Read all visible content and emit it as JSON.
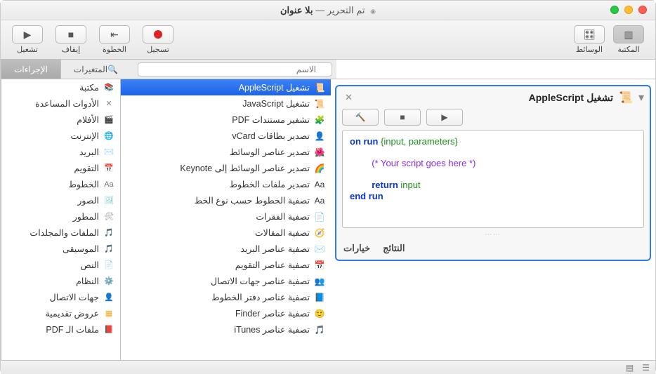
{
  "window": {
    "title_prefix": "تم التحرير — ",
    "title_doc": "بلا عنوان"
  },
  "toolbar": {
    "library": "المكتبة",
    "media": "الوسائط",
    "record": "تسجيل",
    "step": "الخطوة",
    "stop": "إيقاف",
    "run": "تشغيل"
  },
  "tabs": {
    "actions": "الإجراءات",
    "variables": "المتغيرات",
    "search_placeholder": "الاسم"
  },
  "categories": [
    {
      "icon": "📚",
      "color": "#a0d468",
      "label": "مكتبة"
    },
    {
      "icon": "✕",
      "color": "#888",
      "label": "الأدوات المساعدة"
    },
    {
      "icon": "🎬",
      "color": "#333",
      "label": "الأفلام"
    },
    {
      "icon": "🌐",
      "color": "#3a82f7",
      "label": "الإنترنت"
    },
    {
      "icon": "✉️",
      "color": "#6aa9ff",
      "label": "البريد"
    },
    {
      "icon": "📅",
      "color": "#ff6b6b",
      "label": "التقويم"
    },
    {
      "icon": "Aa",
      "color": "#777",
      "label": "الخطوط"
    },
    {
      "icon": "🖼",
      "color": "#6cc",
      "label": "الصور"
    },
    {
      "icon": "🛠",
      "color": "#888",
      "label": "المطور"
    },
    {
      "icon": "🎵",
      "color": "#e66",
      "label": "الملفات والمجلدات"
    },
    {
      "icon": "🎵",
      "color": "#b084f5",
      "label": "الموسيقى"
    },
    {
      "icon": "📄",
      "color": "#aaa",
      "label": "النص"
    },
    {
      "icon": "⚙️",
      "color": "#888",
      "label": "النظام"
    },
    {
      "icon": "👤",
      "color": "#c8925c",
      "label": "جهات الاتصال"
    },
    {
      "icon": "▦",
      "color": "#f5a623",
      "label": "عروض تقديمية"
    },
    {
      "icon": "📕",
      "color": "#d24",
      "label": "ملفات الـ PDF"
    }
  ],
  "actions": [
    {
      "icon": "📜",
      "label": "تشغيل AppleScript",
      "sel": true
    },
    {
      "icon": "📜",
      "label": "تشغيل JavaScript"
    },
    {
      "icon": "🧩",
      "label": "تشفير مستندات PDF"
    },
    {
      "icon": "👤",
      "label": "تصدير بطاقات vCard"
    },
    {
      "icon": "🌺",
      "label": "تصدير عناصر الوسائط"
    },
    {
      "icon": "🌈",
      "label": "تصدير عناصر الوسائط إلى Keynote"
    },
    {
      "icon": "Aa",
      "label": "تصدير ملفات الخطوط"
    },
    {
      "icon": "Aa",
      "label": "تصفية الخطوط حسب نوع الخط"
    },
    {
      "icon": "📄",
      "label": "تصفية الفقرات"
    },
    {
      "icon": "🧭",
      "label": "تصفية المقالات"
    },
    {
      "icon": "✉️",
      "label": "تصفية عناصر البريد"
    },
    {
      "icon": "📅",
      "label": "تصفية عناصر التقويم"
    },
    {
      "icon": "👥",
      "label": "تصفية عناصر جهات الاتصال"
    },
    {
      "icon": "📘",
      "label": "تصفية عناصر دفتر الخطوط"
    },
    {
      "icon": "🙂",
      "label": "تصفية عناصر Finder"
    },
    {
      "icon": "🎵",
      "label": "تصفية عناصر iTunes"
    }
  ],
  "workflow": {
    "title": "تشغيل AppleScript",
    "code_l1a": "on run ",
    "code_l1b": "{input, parameters}",
    "code_l2": "(* Your script goes here *)",
    "code_l3a": "return ",
    "code_l3b": "input",
    "code_l4": "end run",
    "results": "النتائج",
    "options": "خيارات"
  }
}
